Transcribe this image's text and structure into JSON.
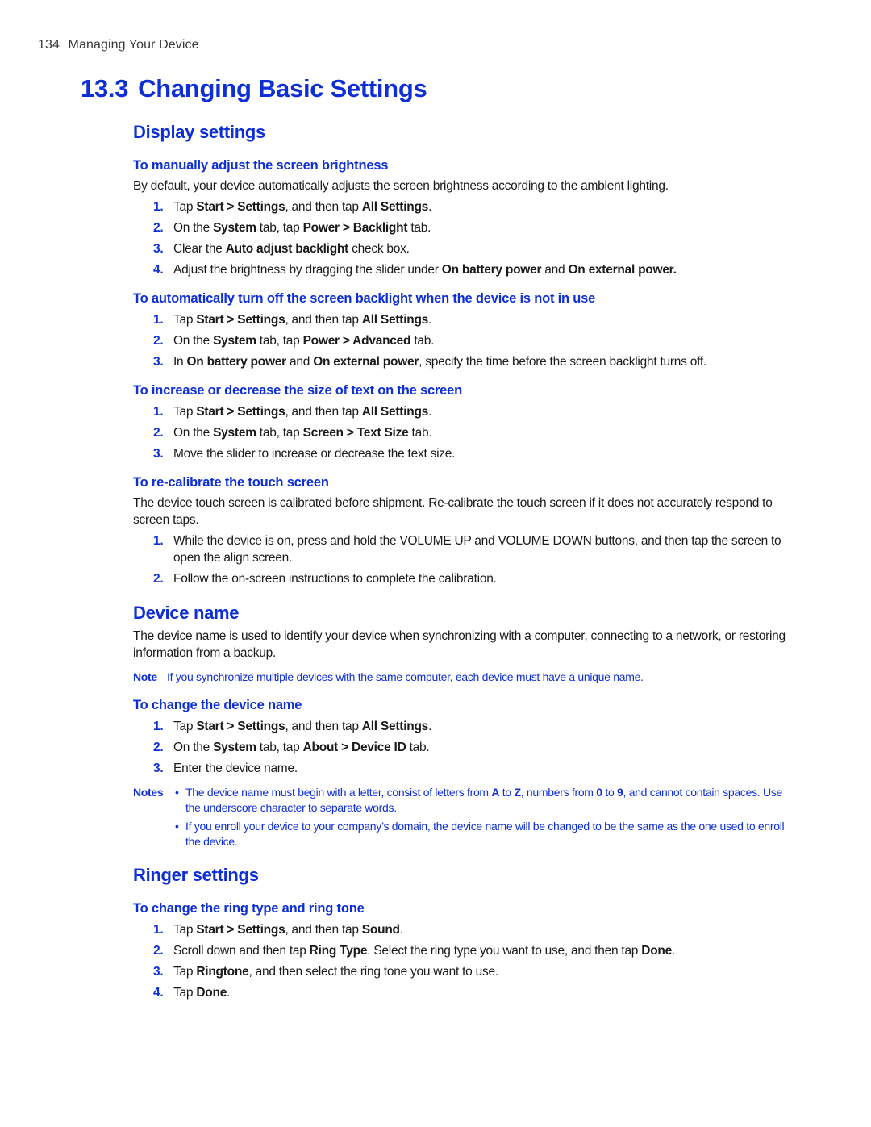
{
  "page_header": {
    "page_number": "134",
    "chapter_name": "Managing Your Device"
  },
  "chapter": {
    "number": "13.3",
    "title": "Changing Basic Settings"
  },
  "colors": {
    "accent_blue": "#0f2fd6",
    "body_text": "#1a1a1a"
  },
  "display_settings": {
    "title": "Display settings",
    "brightness": {
      "title": "To manually adjust the screen brightness",
      "intro": "By default, your device automatically adjusts the screen brightness according to the ambient lighting.",
      "steps": [
        {
          "num": "1.",
          "parts": [
            {
              "t": "Tap "
            },
            {
              "t": "Start > Settings",
              "b": true
            },
            {
              "t": ", and then tap "
            },
            {
              "t": "All Settings",
              "b": true
            },
            {
              "t": "."
            }
          ]
        },
        {
          "num": "2.",
          "parts": [
            {
              "t": "On the "
            },
            {
              "t": "System",
              "b": true
            },
            {
              "t": " tab, tap "
            },
            {
              "t": "Power > Backlight",
              "b": true
            },
            {
              "t": " tab."
            }
          ]
        },
        {
          "num": "3.",
          "parts": [
            {
              "t": "Clear the "
            },
            {
              "t": "Auto adjust backlight",
              "b": true
            },
            {
              "t": " check box."
            }
          ]
        },
        {
          "num": "4.",
          "parts": [
            {
              "t": "Adjust the brightness by dragging the slider under "
            },
            {
              "t": "On battery power",
              "b": true
            },
            {
              "t": " and "
            },
            {
              "t": "On external power.",
              "b": true
            }
          ]
        }
      ]
    },
    "backlight_off": {
      "title": "To automatically turn off the screen backlight when the device is not in use",
      "steps": [
        {
          "num": "1.",
          "parts": [
            {
              "t": "Tap "
            },
            {
              "t": "Start > Settings",
              "b": true
            },
            {
              "t": ", and then tap "
            },
            {
              "t": "All Settings",
              "b": true
            },
            {
              "t": "."
            }
          ]
        },
        {
          "num": "2.",
          "parts": [
            {
              "t": "On the "
            },
            {
              "t": "System",
              "b": true
            },
            {
              "t": " tab, tap "
            },
            {
              "t": "Power > Advanced",
              "b": true
            },
            {
              "t": " tab."
            }
          ]
        },
        {
          "num": "3.",
          "parts": [
            {
              "t": "In "
            },
            {
              "t": "On battery power",
              "b": true
            },
            {
              "t": " and "
            },
            {
              "t": "On external power",
              "b": true
            },
            {
              "t": ", specify the time before the screen backlight turns off."
            }
          ]
        }
      ]
    },
    "text_size": {
      "title": "To increase or decrease the size of text on the screen",
      "steps": [
        {
          "num": "1.",
          "parts": [
            {
              "t": "Tap "
            },
            {
              "t": "Start > Settings",
              "b": true
            },
            {
              "t": ", and then tap "
            },
            {
              "t": "All Settings",
              "b": true
            },
            {
              "t": "."
            }
          ]
        },
        {
          "num": "2.",
          "parts": [
            {
              "t": "On the "
            },
            {
              "t": "System",
              "b": true
            },
            {
              "t": " tab, tap "
            },
            {
              "t": "Screen > Text Size",
              "b": true
            },
            {
              "t": " tab."
            }
          ]
        },
        {
          "num": "3.",
          "parts": [
            {
              "t": "Move the slider to increase or decrease the text size."
            }
          ]
        }
      ]
    },
    "calibrate": {
      "title": "To re-calibrate the touch screen",
      "intro": "The device touch screen is calibrated before shipment. Re-calibrate the touch screen if it does not accurately respond to screen taps.",
      "steps": [
        {
          "num": "1.",
          "parts": [
            {
              "t": "While the device is on, press and hold the VOLUME UP and VOLUME DOWN buttons, and then tap the screen to open the align screen."
            }
          ]
        },
        {
          "num": "2.",
          "parts": [
            {
              "t": "Follow the on-screen instructions to complete the calibration."
            }
          ]
        }
      ]
    }
  },
  "device_name": {
    "title": "Device name",
    "intro": "The device name is used to identify your device when synchronizing with a computer, connecting to a network, or restoring information from a backup.",
    "note_label": "Note",
    "note_text": "If you synchronize multiple devices with the same computer, each device must have a unique name.",
    "change": {
      "title": "To change the device name",
      "steps": [
        {
          "num": "1.",
          "parts": [
            {
              "t": "Tap "
            },
            {
              "t": "Start > Settings",
              "b": true
            },
            {
              "t": ", and then tap "
            },
            {
              "t": "All Settings",
              "b": true
            },
            {
              "t": "."
            }
          ]
        },
        {
          "num": "2.",
          "parts": [
            {
              "t": "On the "
            },
            {
              "t": "System",
              "b": true
            },
            {
              "t": " tab, tap "
            },
            {
              "t": "About > Device ID",
              "b": true
            },
            {
              "t": " tab."
            }
          ]
        },
        {
          "num": "3.",
          "parts": [
            {
              "t": "Enter the device name."
            }
          ]
        }
      ]
    },
    "notes_label": "Notes",
    "notes": [
      {
        "parts": [
          {
            "t": "The device name must begin with a letter, consist of letters from "
          },
          {
            "t": "A",
            "b": true
          },
          {
            "t": " to "
          },
          {
            "t": "Z",
            "b": true
          },
          {
            "t": ", numbers from "
          },
          {
            "t": "0",
            "b": true
          },
          {
            "t": " to "
          },
          {
            "t": "9",
            "b": true
          },
          {
            "t": ", and cannot contain spaces. Use the underscore character to separate words."
          }
        ]
      },
      {
        "parts": [
          {
            "t": "If you enroll your device to your company’s domain, the device name will be changed to be the same as the one used to enroll the device."
          }
        ]
      }
    ]
  },
  "ringer_settings": {
    "title": "Ringer settings",
    "ring": {
      "title": "To change the ring type and ring tone",
      "steps": [
        {
          "num": "1.",
          "parts": [
            {
              "t": "Tap "
            },
            {
              "t": "Start > Settings",
              "b": true
            },
            {
              "t": ", and then tap "
            },
            {
              "t": "Sound",
              "b": true
            },
            {
              "t": "."
            }
          ]
        },
        {
          "num": "2.",
          "parts": [
            {
              "t": "Scroll down and then tap "
            },
            {
              "t": "Ring Type",
              "b": true
            },
            {
              "t": ". Select the ring type you want to use, and then tap "
            },
            {
              "t": "Done",
              "b": true
            },
            {
              "t": "."
            }
          ]
        },
        {
          "num": "3.",
          "parts": [
            {
              "t": "Tap "
            },
            {
              "t": "Ringtone",
              "b": true
            },
            {
              "t": ", and then select the ring tone you want to use."
            }
          ]
        },
        {
          "num": "4.",
          "parts": [
            {
              "t": "Tap "
            },
            {
              "t": "Done",
              "b": true
            },
            {
              "t": "."
            }
          ]
        }
      ]
    }
  }
}
